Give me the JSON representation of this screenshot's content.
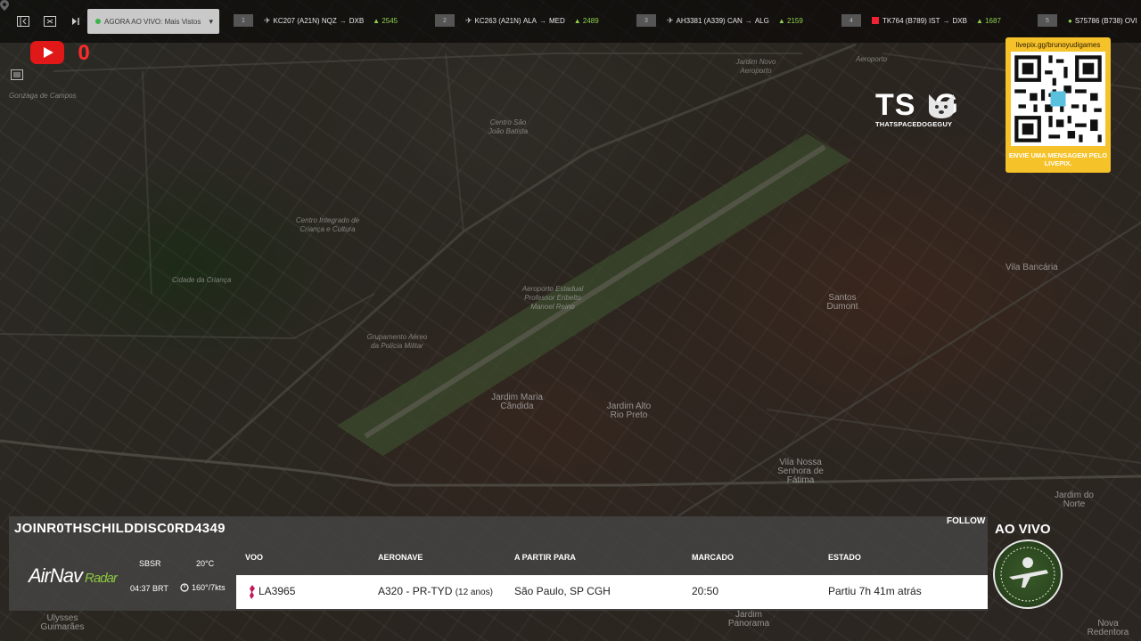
{
  "topbar": {
    "live_label": "AGORA AO VIVO: Mais Vistos",
    "flights": [
      {
        "index": "1",
        "callsign": "KC207 (A21N)",
        "from": "NQZ",
        "to": "DXB",
        "alt": "2545"
      },
      {
        "index": "2",
        "callsign": "KC263 (A21N)",
        "from": "ALA",
        "to": "MED",
        "alt": "2489"
      },
      {
        "index": "3",
        "callsign": "AH3381 (A339)",
        "from": "CAN",
        "to": "ALG",
        "alt": "2159"
      },
      {
        "index": "4",
        "callsign": "TK764 (B789)",
        "from": "IST",
        "to": "DXB",
        "alt": "1687"
      },
      {
        "index": "5",
        "callsign": "S75786 (B738)",
        "from": "OVI",
        "to": "",
        "alt": ""
      }
    ]
  },
  "overlay": {
    "youtube_count": "0",
    "logo_text": "TS  G",
    "logo_sub": "THATSPACEDOGEGUY",
    "qr_url": "livepix.gg/brunoyudigames",
    "qr_message": "ENVIE UMA MENSAGEM PELO LIVEPIX."
  },
  "map": {
    "labels": [
      "Gonzaga de Campos",
      "Jardim Novo Aeroporto",
      "Aeroporto",
      "Centro Integrado de Criança e Cultura",
      "Cidade da Criança",
      "Aeroporto Estadual Professor Eribelto Manoel Reino",
      "Grupamento Aéreo da Polícia Militar",
      "Jardim Maria Cândida",
      "Jardim Alto Rio Preto",
      "Santos Dumont",
      "Vila Bancária",
      "Vila Nossa Senhora de Fátima",
      "Jardim do Norte",
      "Ulysses Guimarães",
      "Jardim Panorama",
      "Nova Redentora",
      "Centro São João Batista"
    ]
  },
  "panel": {
    "channel": "JOINR0THSCHILDDISC0RD4349",
    "follow": "FOLLOW",
    "live_title": "AO VIVO",
    "brand": "AirNav",
    "brand_suffix": "Radar",
    "airport": "SBSR",
    "temp": "20°C",
    "time": "04:37 BRT",
    "wind": "160°/7kts",
    "headers": {
      "voo": "VOO",
      "aeronave": "AERONAVE",
      "rota": "A PARTIR PARA",
      "marcado": "MARCADO",
      "estado": "ESTADO"
    },
    "row": {
      "voo": "LA3965",
      "aeronave": "A320 - PR-TYD",
      "age": "(12 anos)",
      "rota": "São Paulo, SP CGH",
      "marcado": "20:50",
      "estado": "Partiu 7h 41m atrás"
    }
  },
  "colors": {
    "accent_green": "#8cc63f",
    "qr_yellow": "#f6c22a",
    "youtube_red": "#e01818"
  }
}
